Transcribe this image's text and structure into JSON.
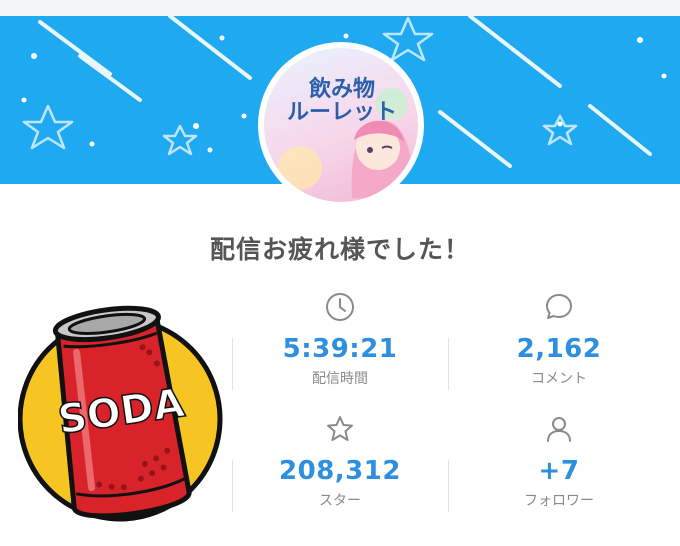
{
  "header": {
    "banner_color": "#1fa9f0",
    "avatar_title_line1": "飲み物",
    "avatar_title_line2": "ルーレット"
  },
  "message": "配信お疲れ様でした！",
  "stats": {
    "duration": {
      "icon": "clock-icon",
      "value": "5:39:21",
      "label": "配信時間"
    },
    "comments": {
      "icon": "speech-bubble-icon",
      "value": "2,162",
      "label": "コメント"
    },
    "stars": {
      "icon": "star-icon",
      "value": "208,312",
      "label": "スター"
    },
    "followers": {
      "icon": "person-icon",
      "value": "+7",
      "label": "フォロワー"
    }
  },
  "overlay": {
    "sticker_text": "SODA",
    "icon": "soda-can-icon"
  },
  "colors": {
    "accent": "#2d8fe0",
    "label": "#8a8a8a",
    "title": "#555555"
  }
}
